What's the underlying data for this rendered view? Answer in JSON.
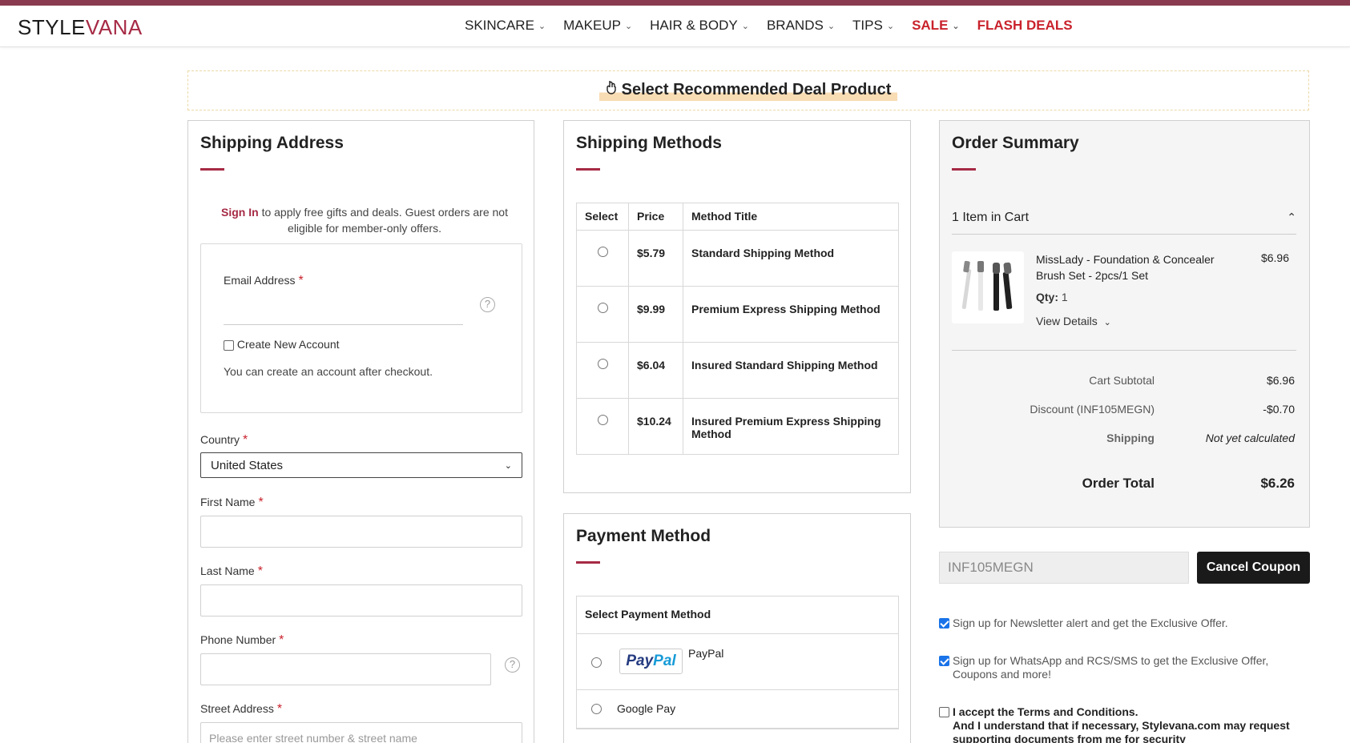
{
  "brand": {
    "logo_main": "STYLE",
    "logo_accent": "VANA",
    "accent_color": "#a62a45"
  },
  "nav": {
    "items": [
      {
        "label": "SKINCARE",
        "has_dropdown": true,
        "red": false
      },
      {
        "label": "MAKEUP",
        "has_dropdown": true,
        "red": false
      },
      {
        "label": "HAIR & BODY",
        "has_dropdown": true,
        "red": false
      },
      {
        "label": "BRANDS",
        "has_dropdown": true,
        "red": false
      },
      {
        "label": "TIPS",
        "has_dropdown": true,
        "red": false
      },
      {
        "label": "SALE",
        "has_dropdown": true,
        "red": true
      },
      {
        "label": "FLASH DEALS",
        "has_dropdown": false,
        "red": true
      }
    ]
  },
  "deal_banner": {
    "label": "Select Recommended Deal Product",
    "icon": "hand-pointer-icon"
  },
  "shipping_address": {
    "title": "Shipping Address",
    "sign_in_link": "Sign In",
    "sign_in_note": " to apply free gifts and deals. Guest orders are not eligible for member-only offers.",
    "email_label": "Email Address",
    "create_account_label": "Create New Account",
    "create_account_note": "You can create an account after checkout.",
    "country_label": "Country",
    "country_value": "United States",
    "first_name_label": "First Name",
    "last_name_label": "Last Name",
    "phone_label": "Phone Number",
    "street_label": "Street Address",
    "street_placeholder": "Please enter street number & street name",
    "required_mark": "*"
  },
  "shipping_methods": {
    "title": "Shipping Methods",
    "columns": [
      "Select",
      "Price",
      "Method Title"
    ],
    "rows": [
      {
        "price": "$5.79",
        "title": "Standard Shipping Method"
      },
      {
        "price": "$9.99",
        "title": "Premium Express Shipping Method"
      },
      {
        "price": "$6.04",
        "title": "Insured Standard Shipping Method"
      },
      {
        "price": "$10.24",
        "title": "Insured Premium Express Shipping Method"
      }
    ]
  },
  "payment": {
    "title": "Payment Method",
    "header": "Select Payment Method",
    "paypal_label": "PayPal",
    "paypal_logo_a": "Pay",
    "paypal_logo_b": "Pal",
    "google_pay_label": "Google Pay"
  },
  "order_summary": {
    "title": "Order Summary",
    "cart_count": "1 Item in Cart",
    "product": {
      "name": "MissLady - Foundation & Concealer Brush Set - 2pcs/1 Set",
      "price": "$6.96",
      "qty_label": "Qty:",
      "qty_value": "1",
      "view_details": "View Details"
    },
    "cart_subtotal_label": "Cart Subtotal",
    "cart_subtotal_value": "$6.96",
    "discount_label": "Discount (INF105MEGN)",
    "discount_value": "-$0.70",
    "shipping_label": "Shipping",
    "shipping_value": "Not yet calculated",
    "order_total_label": "Order Total",
    "order_total_value": "$6.26"
  },
  "coupon": {
    "code": "INF105MEGN",
    "cancel_label": "Cancel Coupon"
  },
  "opt_ins": {
    "newsletter": "Sign up for Newsletter alert and get the Exclusive Offer.",
    "whatsapp": "Sign up for WhatsApp and RCS/SMS to get the Exclusive Offer, Coupons and more!",
    "terms_prefix": "I accept the ",
    "terms_link": "Terms and Conditions.",
    "terms_extra": "And I understand that if necessary, Stylevana.com may request supporting documents from me for security"
  }
}
